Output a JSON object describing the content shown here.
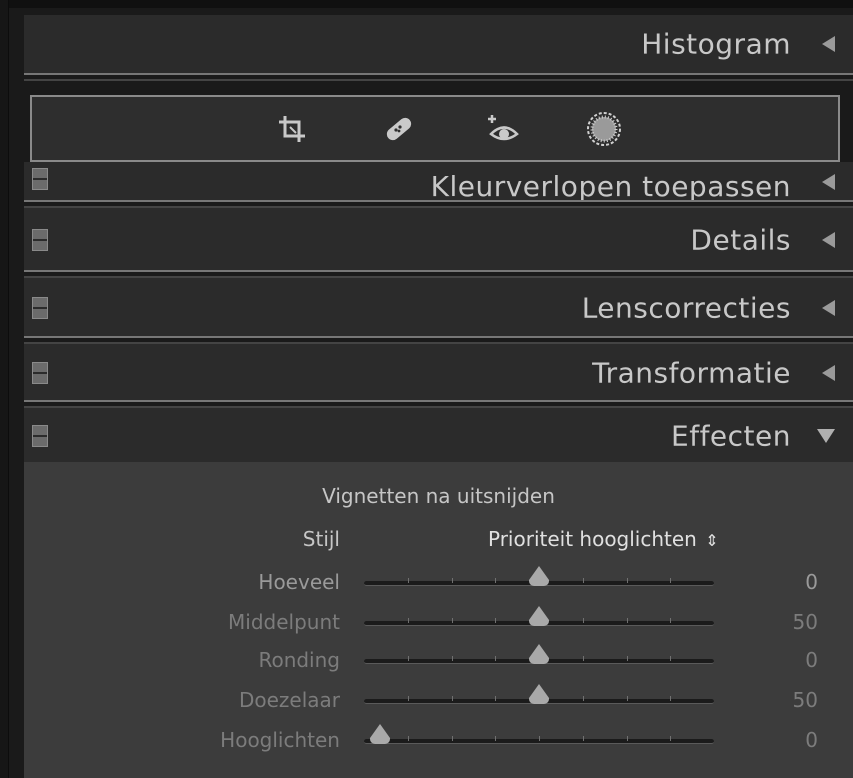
{
  "histogram": {
    "title": "Histogram"
  },
  "toolbar": {
    "tools": [
      {
        "icon": "crop-icon"
      },
      {
        "icon": "spot-removal-icon"
      },
      {
        "icon": "red-eye-icon"
      },
      {
        "icon": "radial-filter-icon"
      }
    ]
  },
  "panels": [
    {
      "title": "Kleurverlopen toepassen",
      "state": "collapsed"
    },
    {
      "title": "Details",
      "state": "collapsed"
    },
    {
      "title": "Lenscorrecties",
      "state": "collapsed"
    },
    {
      "title": "Transformatie",
      "state": "collapsed"
    },
    {
      "title": "Effecten",
      "state": "expanded"
    }
  ],
  "effects": {
    "section_title": "Vignetten na uitsnijden",
    "style_label": "Stijl",
    "style_value": "Prioriteit hooglichten",
    "style_chevron": "⇕",
    "sliders": [
      {
        "label": "Hoeveel",
        "value": "0",
        "position": 0.5,
        "enabled": true
      },
      {
        "label": "Middelpunt",
        "value": "50",
        "position": 0.5,
        "enabled": false
      },
      {
        "label": "Ronding",
        "value": "0",
        "position": 0.5,
        "enabled": false
      },
      {
        "label": "Doezelaar",
        "value": "50",
        "position": 0.5,
        "enabled": false
      },
      {
        "label": "Hooglichten",
        "value": "0",
        "position": 0.0,
        "enabled": false
      }
    ]
  }
}
